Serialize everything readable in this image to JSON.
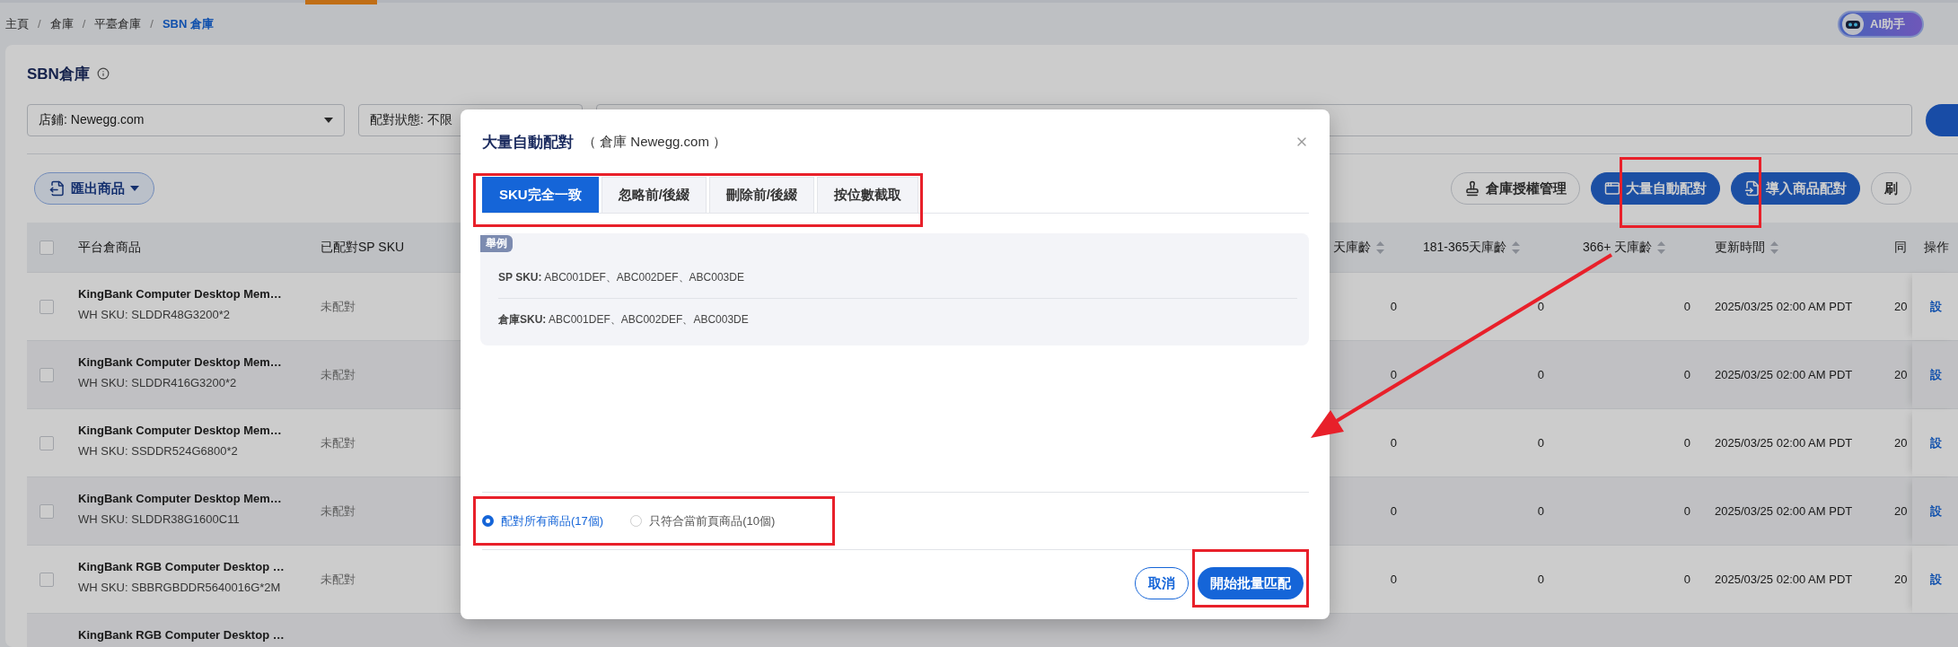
{
  "breadcrumb": {
    "separator": "/",
    "items": [
      {
        "label": "主頁",
        "current": false
      },
      {
        "label": "倉庫",
        "current": false
      },
      {
        "label": "平臺倉庫",
        "current": false
      },
      {
        "label": "SBN 倉庫",
        "current": true
      }
    ]
  },
  "ai_assistant": {
    "label": "AI助手"
  },
  "page": {
    "title": "SBN倉庫"
  },
  "filters": {
    "store": "店鋪: Newegg.com",
    "match_status": "配對狀態: 不限"
  },
  "toolbar": {
    "export": "匯出商品",
    "buttons": [
      {
        "label": "倉庫授權管理",
        "kind": "outline"
      },
      {
        "label": "大量自動配對",
        "kind": "primary"
      },
      {
        "label": "導入商品配對",
        "kind": "primary"
      },
      {
        "label": "刷",
        "kind": "outline"
      }
    ]
  },
  "table": {
    "header_checked": false,
    "columns": [
      {
        "label": "平台倉商品",
        "sortable": false
      },
      {
        "label": "已配對SP SKU",
        "sortable": false
      },
      {
        "label": "天庫齡",
        "sortable": true
      },
      {
        "label": "181-365天庫齡",
        "sortable": true
      },
      {
        "label": "366+ 天庫齡",
        "sortable": true
      },
      {
        "label": "更新時間",
        "sortable": true
      },
      {
        "label": "同"
      },
      {
        "label": "操作",
        "sortable": false
      }
    ],
    "rows": [
      {
        "checked": false,
        "name": "KingBank Computer Desktop Mem…",
        "sku": "WH SKU: SLDDR48G3200*2",
        "status": "未配對",
        "age_a": "0",
        "age_b": "0",
        "age_c": "0",
        "updated": "2025/03/25 02:00 AM PDT",
        "sync": "20",
        "action": "設"
      },
      {
        "checked": false,
        "name": "KingBank Computer Desktop Mem…",
        "sku": "WH SKU: SLDDR416G3200*2",
        "status": "未配對",
        "age_a": "0",
        "age_b": "0",
        "age_c": "0",
        "updated": "2025/03/25 02:00 AM PDT",
        "sync": "20",
        "action": "設"
      },
      {
        "checked": false,
        "name": "KingBank Computer Desktop Mem…",
        "sku": "WH SKU: SSDDR524G6800*2",
        "status": "未配對",
        "age_a": "0",
        "age_b": "0",
        "age_c": "0",
        "updated": "2025/03/25 02:00 AM PDT",
        "sync": "20",
        "action": "設"
      },
      {
        "checked": false,
        "name": "KingBank Computer Desktop Mem…",
        "sku": "WH SKU: SLDDR38G1600C11",
        "status": "未配對",
        "age_a": "0",
        "age_b": "0",
        "age_c": "0",
        "updated": "2025/03/25 02:00 AM PDT",
        "sync": "20",
        "action": "設"
      },
      {
        "checked": false,
        "name": "KingBank RGB Computer Desktop …",
        "sku": "WH SKU: SBBRGBDDR5640016G*2M",
        "status": "未配對",
        "age_a": "0",
        "age_b": "0",
        "age_c": "0",
        "updated": "2025/03/25 02:00 AM PDT",
        "sync": "20",
        "action": "設"
      },
      {
        "name": "KingBank RGB Computer Desktop …"
      }
    ]
  },
  "modal": {
    "title": "大量自動配對",
    "subtitle": "（ 倉庫 Newegg.com ）",
    "tabs": [
      {
        "label": "SKU完全一致",
        "selected": true
      },
      {
        "label": "忽略前/後綴",
        "selected": false
      },
      {
        "label": "刪除前/後綴",
        "selected": false
      },
      {
        "label": "按位數截取",
        "selected": false
      }
    ],
    "example": {
      "badge": "舉例",
      "lines": [
        "**SP SKU:** ABC001DEF、ABC002DEF、ABC003DE",
        "**倉庫SKU:** ABC001DEF、ABC002DEF、ABC003DE"
      ]
    },
    "scope_options": [
      {
        "label": "配對所有商品(17個)",
        "selected": true
      },
      {
        "label": "只符合當前頁商品(10個)",
        "selected": false
      }
    ],
    "cancel": "取消",
    "confirm": "開始批量匹配"
  }
}
